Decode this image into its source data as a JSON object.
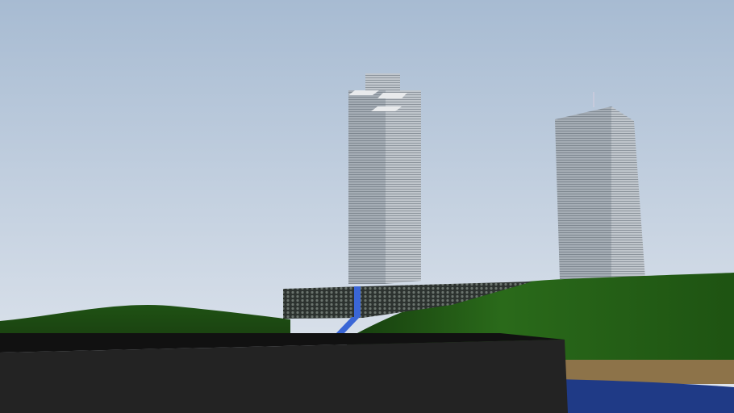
{
  "colors": {
    "sky_top": "#a7bbd2",
    "sky_bottom": "#e3e8ef",
    "hill_dark": "#1d4a12",
    "hill_light": "#2e6e1c",
    "tower_face_left": "#9aa2aa",
    "tower_face_right": "#b8bfc6",
    "podium": "#3a3f3c",
    "accent_blue": "#3a66d6",
    "foreground_block": "#222222",
    "sand": "#8d7349",
    "water": "#1f3a86"
  }
}
